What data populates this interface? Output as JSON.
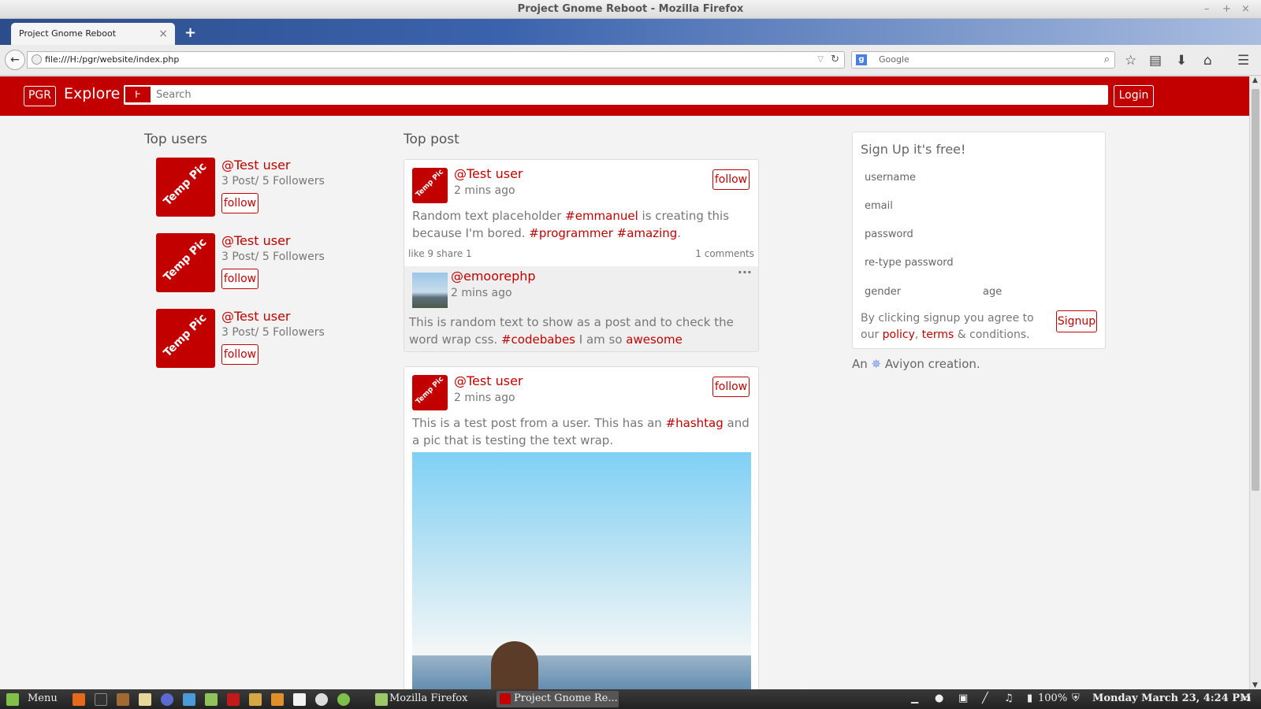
{
  "window": {
    "title": "Project Gnome Reboot - Mozilla Firefox",
    "controls": [
      "–",
      "+",
      "×"
    ]
  },
  "browser": {
    "tab_title": "Project Gnome Reboot",
    "tab_close": "×",
    "new_tab": "+",
    "url": "file:///H:/pgr/website/index.php",
    "search_engine": "Google",
    "search_placeholder": "Google"
  },
  "site": {
    "logo": "PGR",
    "explore": "Explore",
    "search_placeholder": "Search",
    "login": "Login",
    "accent": "#c20000"
  },
  "top_users": {
    "title": "Top users",
    "users": [
      {
        "name": "@Test user",
        "stats": "3 Post/ 5 Followers",
        "follow": "follow",
        "pic": "Temp Pic"
      },
      {
        "name": "@Test user",
        "stats": "3 Post/ 5 Followers",
        "follow": "follow",
        "pic": "Temp Pic"
      },
      {
        "name": "@Test user",
        "stats": "3 Post/ 5 Followers",
        "follow": "follow",
        "pic": "Temp Pic"
      }
    ]
  },
  "top_post": {
    "title": "Top post",
    "post1": {
      "user": "@Test user",
      "time": "2 mins ago",
      "follow": "follow",
      "pic": "Temp Pic",
      "text": [
        "Random text placeholder ",
        "#emmanuel",
        " is creating this because I'm bored. ",
        "#programmer",
        " ",
        "#amazing",
        "."
      ],
      "like": "like",
      "like_count": "9",
      "share": "share",
      "share_count": "1",
      "comments": "1 comments",
      "comment": {
        "user": "@emoorephp",
        "time": "2 mins ago",
        "menu": "···",
        "text": [
          "This is random text to show as a post and to check the word wrap css. ",
          "#codebabes",
          " I am so ",
          "awesome"
        ]
      }
    },
    "post2": {
      "user": "@Test user",
      "time": "2 mins ago",
      "follow": "follow",
      "pic": "Temp Pic",
      "text": [
        "This is a test post from a user. This has an ",
        "#hashtag",
        " and a pic that is testing the text wrap."
      ]
    }
  },
  "signup": {
    "title": "Sign Up it's free!",
    "username": "username",
    "email": "email",
    "password": "password",
    "retype": "re-type password",
    "gender": "gender",
    "age": "age",
    "agree_pre": "By clicking signup you agree to our ",
    "policy": "policy",
    "comma": ", ",
    "terms": "terms",
    "agree_post": " & conditions.",
    "button": "Signup"
  },
  "credit": {
    "pre": "An ",
    "name": "Aviyon creation."
  },
  "taskbar": {
    "menu": "Menu",
    "win1": "Mozilla Firefox",
    "win2": "Project Gnome Re...",
    "battery": "100%",
    "clock": "Monday March 23,  4:24 PM"
  }
}
